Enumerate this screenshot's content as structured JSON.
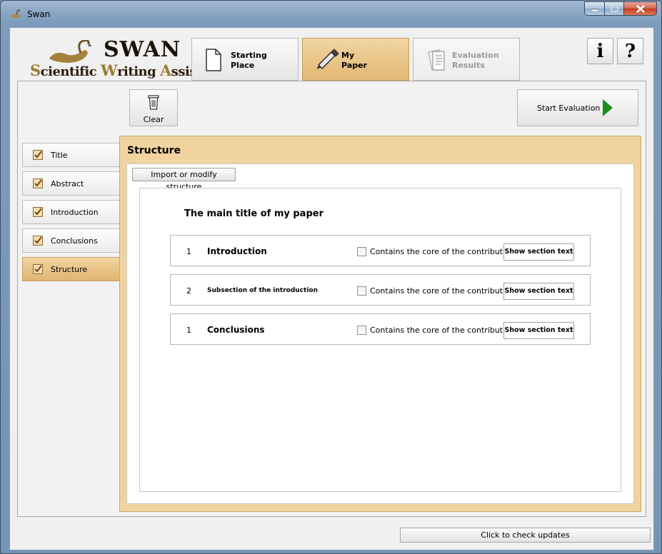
{
  "window": {
    "title": "Swan"
  },
  "logo": {
    "word": "SWAN",
    "subtitle_parts": [
      {
        "text": "S",
        "big": true
      },
      {
        "text": "cientific ",
        "big": false
      },
      {
        "text": "W",
        "big": true
      },
      {
        "text": "riting ",
        "big": false
      },
      {
        "text": "A",
        "big": true
      },
      {
        "text": "ssistant",
        "big": false
      }
    ]
  },
  "tabs": [
    {
      "line1": "Starting",
      "line2": "Place",
      "state": "normal"
    },
    {
      "line1": "My",
      "line2": "Paper",
      "state": "active"
    },
    {
      "line1": "Evaluation",
      "line2": "Results",
      "state": "disabled"
    }
  ],
  "header_buttons": {
    "info": "i",
    "help": "?"
  },
  "toolbar": {
    "clear_label": "Clear",
    "start_eval_label": "Start Evaluation"
  },
  "sidebar": {
    "items": [
      {
        "label": "Title",
        "checked": true
      },
      {
        "label": "Abstract",
        "checked": true
      },
      {
        "label": "Introduction",
        "checked": true
      },
      {
        "label": "Conclusions",
        "checked": true
      },
      {
        "label": "Structure",
        "checked": true,
        "active": true
      }
    ]
  },
  "structure": {
    "heading": "Structure",
    "import_label": "Import or modify structure",
    "paper_title": "The main title of my paper",
    "contains_label": "Contains the core of the contribution",
    "show_label": "Show section text",
    "sections": [
      {
        "number": "1",
        "name": "Introduction",
        "size": "lg"
      },
      {
        "number": "2",
        "name": "Subsection of the introduction",
        "size": "sm"
      },
      {
        "number": "1",
        "name": "Conclusions",
        "size": "lg"
      }
    ]
  },
  "footer": {
    "update_label": "Click to check updates"
  },
  "colors": {
    "accent": "#e6bf7e",
    "frame": "#f0d39e",
    "play": "#1c8c1c"
  }
}
